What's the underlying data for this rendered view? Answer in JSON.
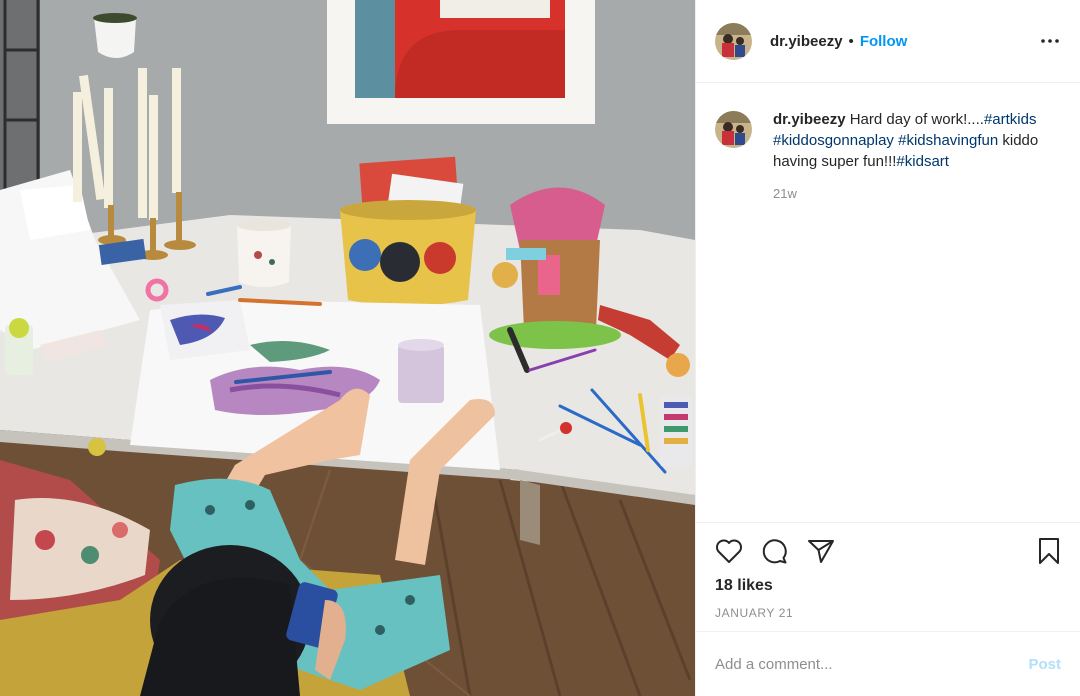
{
  "post": {
    "username": "dr.yibeezy",
    "separator": "•",
    "follow_label": "Follow",
    "more_icon": "more-options-icon"
  },
  "caption": {
    "username": "dr.yibeezy",
    "text_1": " Hard day of work!....",
    "tag_1": "#artkids",
    "space_1": " ",
    "tag_2": "#kiddosgonnaplay",
    "space_2": " ",
    "tag_3": "#kidshavingfun",
    "text_2": " kiddo having super fun!!!",
    "tag_4": "#kidsart",
    "time": "21w"
  },
  "actions": {
    "like_icon": "heart-icon",
    "comment_icon": "comment-icon",
    "share_icon": "share-icon",
    "save_icon": "bookmark-icon",
    "likes": "18 likes",
    "date": "JANUARY 21"
  },
  "comment": {
    "placeholder": "Add a comment...",
    "post_label": "Post"
  },
  "colors": {
    "accent": "#0095f6",
    "hashtag": "#00376b",
    "muted": "#8e8e8e",
    "post_disabled": "#b2dffc"
  }
}
